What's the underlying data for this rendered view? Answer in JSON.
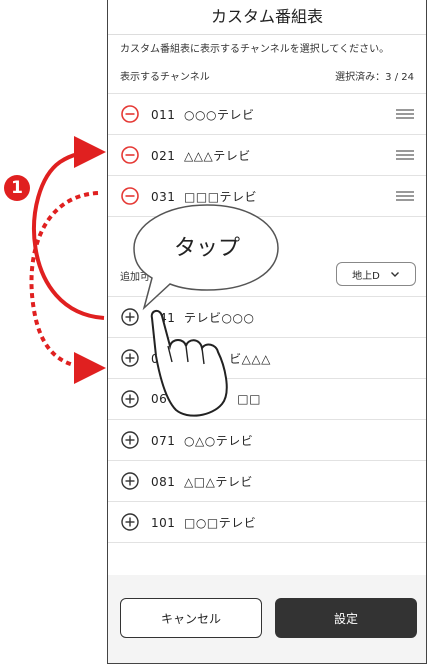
{
  "header": {
    "title": "カスタム番組表"
  },
  "description": "カスタム番組表に表示するチャンネルを選択してください。",
  "shown_section": {
    "label": "表示するチャンネル",
    "count": "選択済み：3 / 24",
    "items": [
      {
        "num": "011",
        "name": "○○○テレビ"
      },
      {
        "num": "021",
        "name": "△△△テレビ"
      },
      {
        "num": "031",
        "name": "□□□テレビ"
      }
    ]
  },
  "add_section": {
    "label": "追加可",
    "filter": "地上D",
    "items": [
      {
        "num": "041",
        "name": "テレビ○○○"
      },
      {
        "num": "0",
        "name": "ビ△△△"
      },
      {
        "num": "06",
        "name": "□□"
      },
      {
        "num": "071",
        "name": "○△○テレビ"
      },
      {
        "num": "081",
        "name": "△□△テレビ"
      },
      {
        "num": "101",
        "name": "□○□テレビ"
      }
    ]
  },
  "footer": {
    "cancel_label": "キャンセル",
    "ok_label": "設定"
  },
  "annotation": {
    "callout": "タップ",
    "step": "1"
  },
  "colors": {
    "remove": "#e53935",
    "accent_arrow": "#e02020",
    "primary_button": "#333333"
  }
}
